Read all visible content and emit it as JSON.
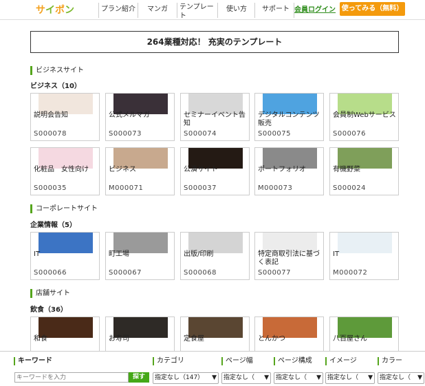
{
  "header": {
    "logo": [
      "サ",
      "イ",
      "ポ",
      "ン"
    ],
    "nav": [
      "プラン紹介",
      "マンガ",
      "テンプレート",
      "使い方",
      "サポート"
    ],
    "login": "会員ログイン",
    "try": "使ってみる（無料）"
  },
  "banner": "264業種対応！ 充実のテンプレート",
  "sections": [
    {
      "title": "ビジネスサイト",
      "subtitle": "ビジネス（10）",
      "rows": [
        [
          {
            "name": "説明会告知",
            "id": "S000078",
            "color": "#f1e6dd"
          },
          {
            "name": "公式メルマガ",
            "id": "S000073",
            "color": "#3a3038"
          },
          {
            "name": "セミナーイベント告知",
            "id": "S000074",
            "color": "#d8d8d8"
          },
          {
            "name": "デジタルコンテンツ販売",
            "id": "S000075",
            "color": "#4fa3e0"
          },
          {
            "name": "会員制Webサービス",
            "id": "S000076",
            "color": "#b7dd8a"
          }
        ],
        [
          {
            "name": "化粧品　女性向け",
            "id": "S000035",
            "color": "#f5d9e1"
          },
          {
            "name": "ビジネス",
            "id": "M000071",
            "color": "#c8a98e"
          },
          {
            "name": "公演サイト",
            "id": "S000037",
            "color": "#241a14"
          },
          {
            "name": "ポートフォリオ",
            "id": "M000073",
            "color": "#8a8a8a"
          },
          {
            "name": "有機野菜",
            "id": "S000024",
            "color": "#7f9f5a"
          }
        ]
      ]
    },
    {
      "title": "コーポレートサイト",
      "subtitle": "企業情報（5）",
      "rows": [
        [
          {
            "name": "IT",
            "id": "S000066",
            "color": "#3c74c4"
          },
          {
            "name": "町工場",
            "id": "S000067",
            "color": "#9a9a9a"
          },
          {
            "name": "出版/印刷",
            "id": "S000068",
            "color": "#d4d4d4"
          },
          {
            "name": "特定商取引法に基づく表記",
            "id": "S000077",
            "color": "#ececec"
          },
          {
            "name": "IT",
            "id": "M000072",
            "color": "#e8f0f5"
          }
        ]
      ]
    },
    {
      "title": "店舗サイト",
      "subtitle": "飲食（36）",
      "rows": [
        [
          {
            "name": "和食",
            "id": "",
            "color": "#4a2a18"
          },
          {
            "name": "お寿司",
            "id": "",
            "color": "#2e2a26"
          },
          {
            "name": "定食屋",
            "id": "",
            "color": "#5a4632"
          },
          {
            "name": "とんかつ",
            "id": "",
            "color": "#c86a38"
          },
          {
            "name": "八百屋さん",
            "id": "",
            "color": "#5e9a3a"
          }
        ]
      ]
    }
  ],
  "filters": {
    "keyword_label": "キーワード",
    "keyword_placeholder": "キーワードを入力",
    "search_button": "探す",
    "category_label": "カテゴリ",
    "category_value": "指定なし（147）",
    "pagewidth_label": "ページ幅",
    "pagewidth_value": "指定なし（",
    "structure_label": "ページ構成",
    "structure_value": "指定なし（",
    "image_label": "イメージ",
    "image_value": "指定なし（",
    "color_label": "カラー",
    "color_value": "指定なし（"
  }
}
